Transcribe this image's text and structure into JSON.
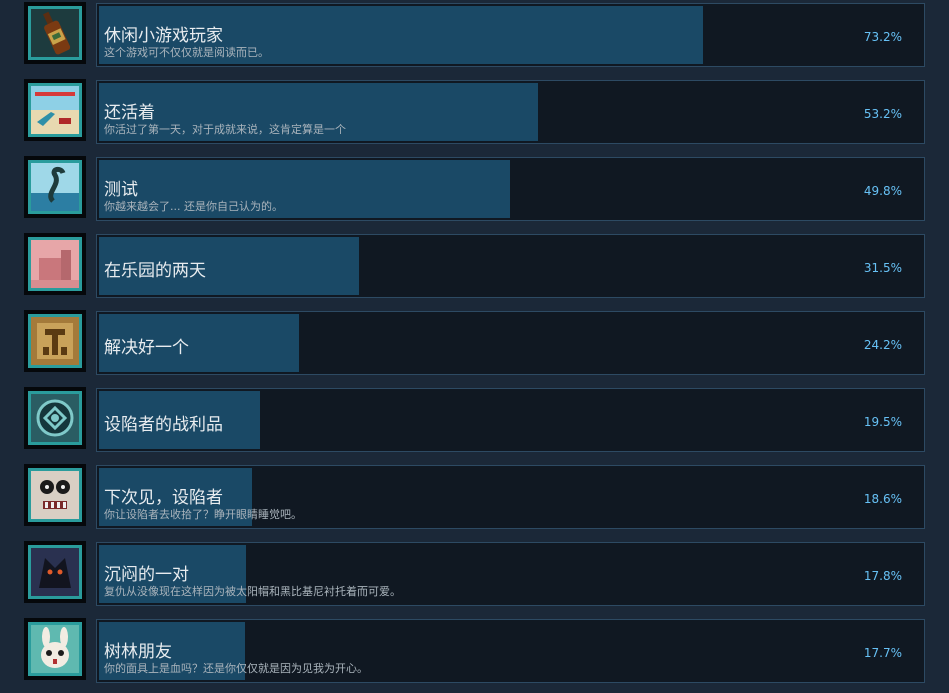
{
  "achievements": [
    {
      "title": "休闲小游戏玩家",
      "description": "这个游戏可不仅仅就是阅读而已。",
      "percent_label": "73.2%",
      "percent": 73.2,
      "icon": "bottle-icon"
    },
    {
      "title": "还活着",
      "description": "你活过了第一天，对于成就来说，这肯定算是一个",
      "percent_label": "53.2%",
      "percent": 53.2,
      "icon": "beach-chair-icon"
    },
    {
      "title": "测试",
      "description": "你越来越会了... 还是你自己认为的。",
      "percent_label": "49.8%",
      "percent": 49.8,
      "icon": "sea-serpent-icon"
    },
    {
      "title": "在乐园的两天",
      "description": "",
      "percent_label": "31.5%",
      "percent": 31.5,
      "icon": "pink-resort-icon"
    },
    {
      "title": "解决好一个",
      "description": "",
      "percent_label": "24.2%",
      "percent": 24.2,
      "icon": "totem-icon"
    },
    {
      "title": "设陷者的战利品",
      "description": "",
      "percent_label": "19.5%",
      "percent": 19.5,
      "icon": "trapper-emblem-icon"
    },
    {
      "title": "下次见，设陷者",
      "description": "你让设陷者去收拾了？睁开眼睛睡觉吧。",
      "percent_label": "18.6%",
      "percent": 18.6,
      "icon": "mask-face-icon"
    },
    {
      "title": "沉闷的一对",
      "description": "复仇从没像现在这样因为被太阳帽和黑比基尼衬托着而可爱。",
      "percent_label": "17.8%",
      "percent": 17.8,
      "icon": "dark-creature-icon"
    },
    {
      "title": "树林朋友",
      "description": "你的面具上是血吗？还是你仅仅就是因为见我为开心。",
      "percent_label": "17.7%",
      "percent": 17.7,
      "icon": "rabbit-mask-icon"
    }
  ],
  "colors": {
    "background": "#1b2838",
    "bar_fill": "#1a4966",
    "percent_text": "#67c1f5",
    "icon_border": "#2a9c9c"
  }
}
